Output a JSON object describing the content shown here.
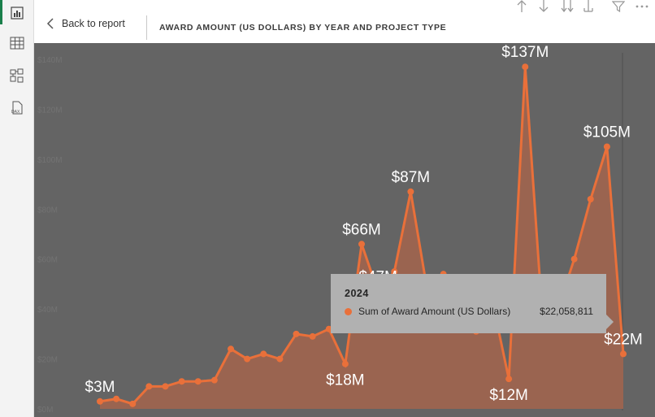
{
  "header": {
    "back_label": "Back to report",
    "title": "AWARD AMOUNT (US DOLLARS) BY YEAR AND PROJECT TYPE"
  },
  "rail": [
    "report-view-icon",
    "table-view-icon",
    "model-view-icon",
    "dax-query-icon"
  ],
  "rail_dax_text": "DAX",
  "toolbar": [
    "drill-up-icon",
    "drill-down-icon",
    "expand-next-level-icon",
    "expand-hierarchy-icon",
    "filter-icon",
    "more-options-icon"
  ],
  "colors": {
    "series": "#e9703a",
    "area": "#9a6450",
    "plot_bg": "#646464",
    "tooltip_bg": "#b1b1b1"
  },
  "chart_data": {
    "type": "area",
    "title": "AWARD AMOUNT (US DOLLARS) BY YEAR AND PROJECT TYPE",
    "ylim": [
      0,
      140
    ],
    "y_tick_labels": [
      "$0M",
      "$20M",
      "$40M",
      "$60M",
      "$80M",
      "$100M",
      "$120M",
      "$140M"
    ],
    "grid": false,
    "series": [
      {
        "values": [
          3,
          4,
          2,
          9,
          9,
          11,
          11,
          11.5,
          24,
          20,
          22,
          20,
          30,
          29,
          32,
          18,
          66,
          47,
          55,
          87,
          48,
          54,
          42,
          31,
          43,
          12,
          137,
          42,
          40,
          60,
          84,
          105,
          22
        ]
      }
    ],
    "data_labels": [
      {
        "index": 0,
        "text": "$3M"
      },
      {
        "index": 15,
        "text": "$18M"
      },
      {
        "index": 16,
        "text": "$66M"
      },
      {
        "index": 17,
        "text": "$47M"
      },
      {
        "index": 19,
        "text": "$87M"
      },
      {
        "index": 25,
        "text": "$12M"
      },
      {
        "index": 26,
        "text": "$137M"
      },
      {
        "index": 31,
        "text": "$105M"
      },
      {
        "index": 32,
        "text": "$22M"
      }
    ]
  },
  "tooltip": {
    "year": "2024",
    "series_name": "Sum of Award Amount (US Dollars)",
    "value": "$22,058,811"
  }
}
